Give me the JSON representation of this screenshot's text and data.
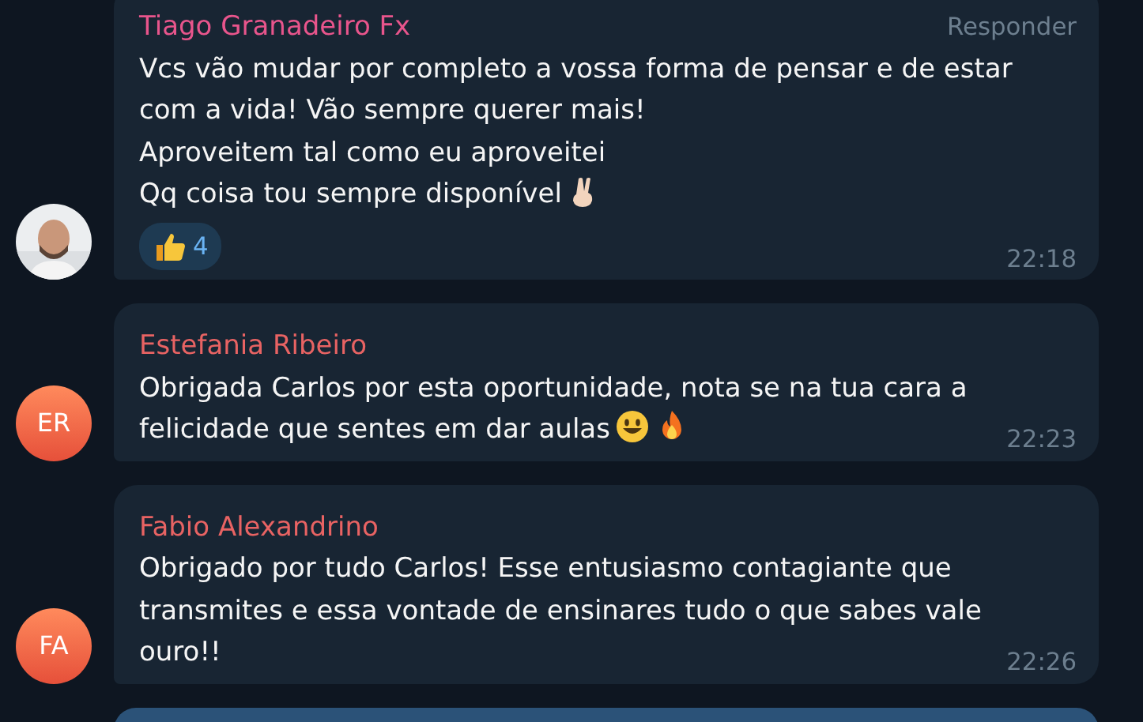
{
  "messages": [
    {
      "avatar": {
        "kind": "picture"
      },
      "sender": {
        "name": "Tiago Granadeiro Fx",
        "color": "#e8558c"
      },
      "reply_label": "Responder",
      "lines": [
        "Vcs vão mudar por completo a vossa forma de pensar e de estar",
        "com a vida! Vão sempre querer mais!",
        "Aproveitem tal como eu aproveitei",
        "Qq coisa tou sempre disponível"
      ],
      "trailing_icons": [
        {
          "kind": "victory-hand"
        }
      ],
      "reaction": {
        "kind": "thumbs-up",
        "count": "4"
      },
      "time": "22:18"
    },
    {
      "avatar": {
        "kind": "initials",
        "initials": "ER"
      },
      "sender": {
        "name": "Estefania Ribeiro",
        "color": "#e86363"
      },
      "lines": [
        "Obrigada Carlos por esta oportunidade, nota se na tua cara a",
        "felicidade que sentes em dar aulas"
      ],
      "trailing_icons": [
        {
          "kind": "smiley"
        },
        {
          "kind": "fire"
        }
      ],
      "time": "22:23"
    },
    {
      "avatar": {
        "kind": "initials",
        "initials": "FA"
      },
      "sender": {
        "name": "Fabio Alexandrino",
        "color": "#e86363"
      },
      "lines": [
        "Obrigado por tudo Carlos! Esse entusiasmo contagiante que",
        "transmites e essa vontade de ensinares tudo o que sabes vale",
        "ouro!!"
      ],
      "time": "22:26"
    }
  ],
  "next_message": {
    "kind": "outgoing"
  }
}
